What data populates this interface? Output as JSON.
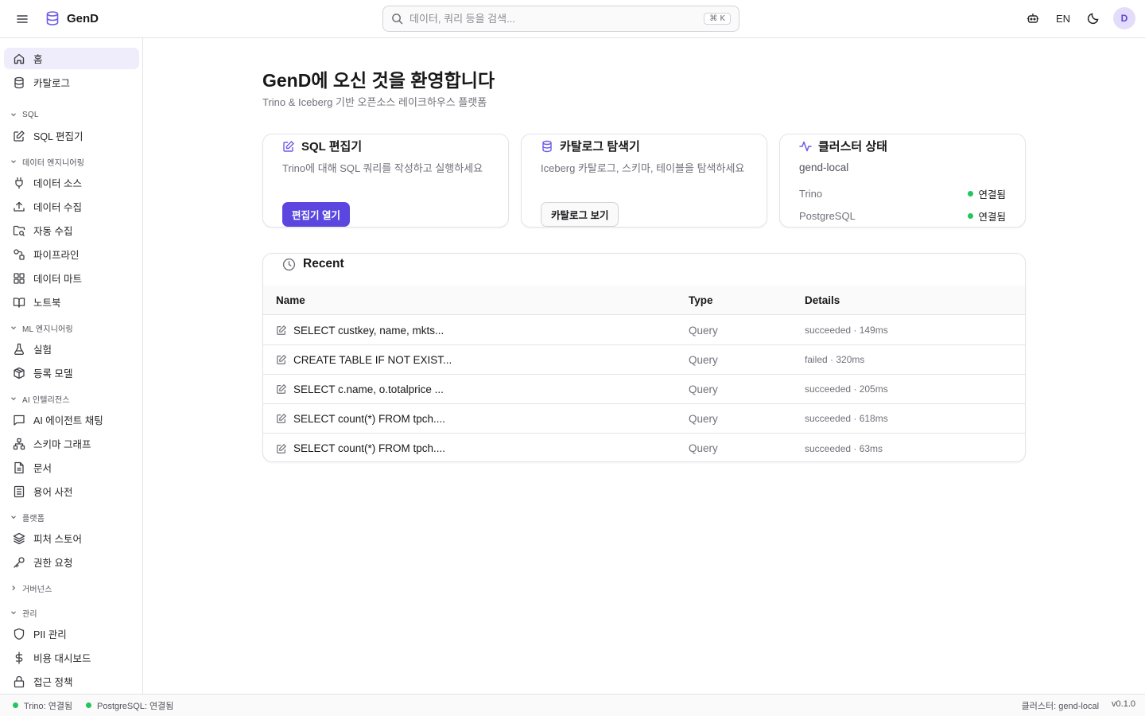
{
  "app": {
    "name": "GenD"
  },
  "search": {
    "placeholder": "데이터, 쿼리 등을 검색...",
    "shortcut": "⌘ K"
  },
  "header": {
    "lang": "EN",
    "avatar": "D"
  },
  "sidebar": {
    "items": {
      "home": "홈",
      "catalog": "카탈로그",
      "sql_editor": "SQL 편집기",
      "data_source": "데이터 소스",
      "data_ingest": "데이터 수집",
      "auto_ingest": "자동 수집",
      "pipeline": "파이프라인",
      "data_mart": "데이터 마트",
      "notebook": "노트북",
      "experiment": "실험",
      "registered_model": "등록 모델",
      "ai_agent_chat": "AI 에이전트 채팅",
      "schema_graph": "스키마 그래프",
      "documents": "문서",
      "glossary": "용어 사전",
      "feature_store": "피처 스토어",
      "access_request": "권한 요청",
      "pii": "PII 관리",
      "cost_dashboard": "비용 대시보드",
      "access_policy": "접근 정책"
    },
    "sections": {
      "sql": "SQL",
      "data_eng": "데이터 엔지니어링",
      "ml_eng": "ML 엔지니어링",
      "ai_intel": "AI 인텔리전스",
      "platform": "플랫폼",
      "governance": "거버넌스",
      "admin": "관리"
    }
  },
  "main": {
    "title": "GenD에 오신 것을 환영합니다",
    "subtitle": "Trino & Iceberg 기반 오픈소스 레이크하우스 플랫폼"
  },
  "cards": {
    "sql": {
      "title": "SQL 편집기",
      "desc": "Trino에 대해 SQL 쿼리를 작성하고 실행하세요",
      "button": "편집기 열기"
    },
    "catalog": {
      "title": "카탈로그 탐색기",
      "desc": "Iceberg 카탈로그, 스키마, 테이블을 탐색하세요",
      "button": "카탈로그 보기"
    },
    "cluster": {
      "title": "클러스터 상태",
      "name": "gend-local",
      "rows": [
        {
          "label": "Trino",
          "status": "연결됨"
        },
        {
          "label": "PostgreSQL",
          "status": "연결됨"
        }
      ]
    }
  },
  "recent": {
    "title": "Recent",
    "columns": {
      "name": "Name",
      "type": "Type",
      "details": "Details"
    },
    "rows": [
      {
        "name": "SELECT custkey, name, mkts...",
        "type": "Query",
        "details": "succeeded · 149ms"
      },
      {
        "name": "CREATE TABLE IF NOT EXIST...",
        "type": "Query",
        "details": "failed · 320ms"
      },
      {
        "name": "SELECT c.name, o.totalprice ...",
        "type": "Query",
        "details": "succeeded · 205ms"
      },
      {
        "name": "SELECT count(*) FROM tpch....",
        "type": "Query",
        "details": "succeeded · 618ms"
      },
      {
        "name": "SELECT count(*) FROM tpch....",
        "type": "Query",
        "details": "succeeded · 63ms"
      }
    ]
  },
  "footer": {
    "trino": "Trino: 연결됨",
    "postgres": "PostgreSQL: 연결됨",
    "cluster": "클러스터: gend-local",
    "version": "v0.1.0"
  },
  "colors": {
    "accent": "#5b46e0",
    "status_ok": "#22c55e"
  }
}
